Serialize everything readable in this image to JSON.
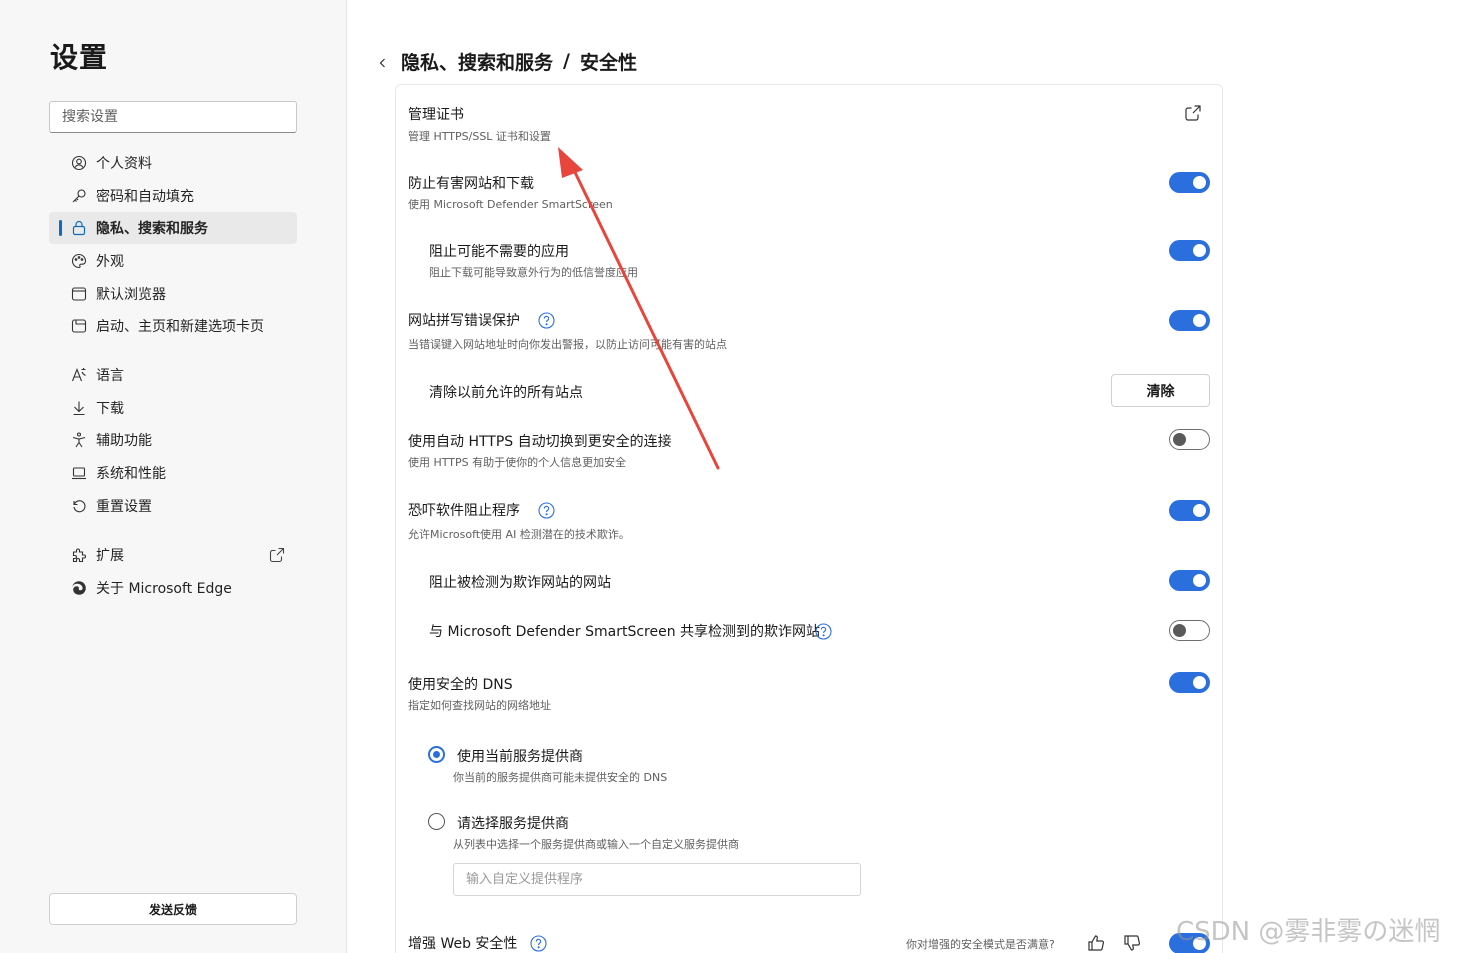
{
  "sidebar": {
    "title": "设置",
    "search_placeholder": "搜索设置",
    "items": [
      {
        "label": "个人资料",
        "icon": "profile-icon"
      },
      {
        "label": "密码和自动填充",
        "icon": "key-icon"
      },
      {
        "label": "隐私、搜索和服务",
        "icon": "lock-icon",
        "active": true
      },
      {
        "label": "外观",
        "icon": "palette-icon"
      },
      {
        "label": "默认浏览器",
        "icon": "browser-icon"
      },
      {
        "label": "启动、主页和新建选项卡页",
        "icon": "home-icon"
      },
      {
        "label": "语言",
        "icon": "language-icon"
      },
      {
        "label": "下载",
        "icon": "download-icon"
      },
      {
        "label": "辅助功能",
        "icon": "accessibility-icon"
      },
      {
        "label": "系统和性能",
        "icon": "laptop-icon"
      },
      {
        "label": "重置设置",
        "icon": "reset-icon"
      },
      {
        "label": "扩展",
        "icon": "puzzle-icon"
      },
      {
        "label": "关于 Microsoft Edge",
        "icon": "edge-icon"
      }
    ],
    "feedback_label": "发送反馈"
  },
  "breadcrumb": {
    "parent": "隐私、搜索和服务",
    "separator": "/",
    "current": "安全性"
  },
  "settings": {
    "certificates": {
      "title": "管理证书",
      "desc": "管理 HTTPS/SSL 证书和设置"
    },
    "smartscreen": {
      "title": "防止有害网站和下载",
      "desc": "使用 Microsoft Defender SmartScreen",
      "on": true
    },
    "pua": {
      "title": "阻止可能不需要的应用",
      "desc": "阻止下载可能导致意外行为的低信誉度应用",
      "on": true
    },
    "typo": {
      "title": "网站拼写错误保护",
      "desc": "当错误键入网站地址时向你发出警报，以防止访问可能有害的站点",
      "on": true
    },
    "clear_allowed": {
      "title": "清除以前允许的所有站点",
      "button": "清除"
    },
    "auto_https": {
      "title": "使用自动 HTTPS 自动切换到更安全的连接",
      "desc": "使用 HTTPS 有助于使你的个人信息更加安全",
      "on": false
    },
    "scareware": {
      "title": "恐吓软件阻止程序",
      "desc": "允许Microsoft使用 AI 检测潜在的技术欺诈。",
      "on": true
    },
    "block_scam": {
      "title": "阻止被检测为欺诈网站的网站",
      "on": true
    },
    "share_scam": {
      "title": "与 Microsoft Defender SmartScreen 共享检测到的欺诈网站",
      "on": false
    },
    "secure_dns": {
      "title": "使用安全的 DNS",
      "desc": "指定如何查找网站的网络地址",
      "on": true
    },
    "dns_current": {
      "title": "使用当前服务提供商",
      "desc": "你当前的服务提供商可能未提供安全的 DNS",
      "checked": true
    },
    "dns_choose": {
      "title": "请选择服务提供商",
      "desc": "从列表中选择一个服务提供商或输入一个自定义服务提供商",
      "checked": false,
      "placeholder": "输入自定义提供程序"
    },
    "web_security": {
      "title": "增强 Web 安全性",
      "feedback_question": "你对增强的安全模式是否满意?",
      "on": true
    }
  },
  "watermark": "CSDN @雾非雾の迷惘",
  "colors": {
    "accent": "#2b6ede",
    "annotation_arrow": "#e8453c"
  }
}
